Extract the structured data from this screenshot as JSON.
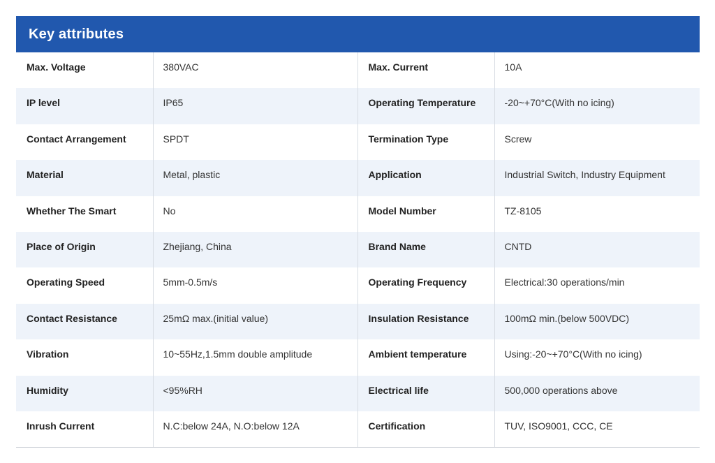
{
  "header": {
    "title": "Key attributes"
  },
  "colors": {
    "header_bg": "#2158ae",
    "alt_row_bg": "#eef3fa"
  },
  "rows": [
    {
      "label1": "Max. Voltage",
      "value1": "380VAC",
      "label2": "Max. Current",
      "value2": "10A"
    },
    {
      "label1": "IP level",
      "value1": "IP65",
      "label2": "Operating Temperature",
      "value2": "-20~+70°C(With no icing)"
    },
    {
      "label1": "Contact Arrangement",
      "value1": "SPDT",
      "label2": "Termination Type",
      "value2": "Screw"
    },
    {
      "label1": "Material",
      "value1": "Metal, plastic",
      "label2": "Application",
      "value2": "Industrial Switch, Industry Equipment"
    },
    {
      "label1": "Whether The Smart",
      "value1": "No",
      "label2": "Model Number",
      "value2": "TZ-8105"
    },
    {
      "label1": "Place of Origin",
      "value1": "Zhejiang, China",
      "label2": "Brand Name",
      "value2": "CNTD"
    },
    {
      "label1": "Operating Speed",
      "value1": "5mm-0.5m/s",
      "label2": "Operating Frequency",
      "value2": "Electrical:30 operations/min"
    },
    {
      "label1": "Contact Resistance",
      "value1": "25mΩ max.(initial value)",
      "label2": "Insulation Resistance",
      "value2": "100mΩ min.(below 500VDC)"
    },
    {
      "label1": "Vibration",
      "value1": "10~55Hz,1.5mm double amplitude",
      "label2": "Ambient temperature",
      "value2": "Using:-20~+70°C(With no icing)"
    },
    {
      "label1": "Humidity",
      "value1": "<95%RH",
      "label2": "Electrical life",
      "value2": "500,000 operations above"
    },
    {
      "label1": "Inrush Current",
      "value1": "N.C:below 24A, N.O:below 12A",
      "label2": "Certification",
      "value2": "TUV, ISO9001, CCC, CE"
    }
  ]
}
